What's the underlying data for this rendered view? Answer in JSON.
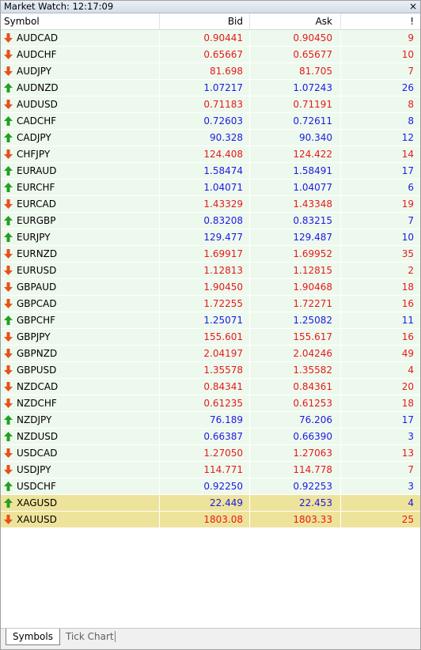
{
  "window": {
    "title": "Market Watch: 12:17:09",
    "close_glyph": "×"
  },
  "columns": {
    "symbol": "Symbol",
    "bid": "Bid",
    "ask": "Ask",
    "spread": "!"
  },
  "rows": [
    {
      "symbol": "AUDCAD",
      "bid": "0.90441",
      "ask": "0.90450",
      "spread": "9",
      "dir": "down"
    },
    {
      "symbol": "AUDCHF",
      "bid": "0.65667",
      "ask": "0.65677",
      "spread": "10",
      "dir": "down"
    },
    {
      "symbol": "AUDJPY",
      "bid": "81.698",
      "ask": "81.705",
      "spread": "7",
      "dir": "down"
    },
    {
      "symbol": "AUDNZD",
      "bid": "1.07217",
      "ask": "1.07243",
      "spread": "26",
      "dir": "up"
    },
    {
      "symbol": "AUDUSD",
      "bid": "0.71183",
      "ask": "0.71191",
      "spread": "8",
      "dir": "down"
    },
    {
      "symbol": "CADCHF",
      "bid": "0.72603",
      "ask": "0.72611",
      "spread": "8",
      "dir": "up"
    },
    {
      "symbol": "CADJPY",
      "bid": "90.328",
      "ask": "90.340",
      "spread": "12",
      "dir": "up"
    },
    {
      "symbol": "CHFJPY",
      "bid": "124.408",
      "ask": "124.422",
      "spread": "14",
      "dir": "down"
    },
    {
      "symbol": "EURAUD",
      "bid": "1.58474",
      "ask": "1.58491",
      "spread": "17",
      "dir": "up"
    },
    {
      "symbol": "EURCHF",
      "bid": "1.04071",
      "ask": "1.04077",
      "spread": "6",
      "dir": "up"
    },
    {
      "symbol": "EURCAD",
      "bid": "1.43329",
      "ask": "1.43348",
      "spread": "19",
      "dir": "down"
    },
    {
      "symbol": "EURGBP",
      "bid": "0.83208",
      "ask": "0.83215",
      "spread": "7",
      "dir": "up"
    },
    {
      "symbol": "EURJPY",
      "bid": "129.477",
      "ask": "129.487",
      "spread": "10",
      "dir": "up"
    },
    {
      "symbol": "EURNZD",
      "bid": "1.69917",
      "ask": "1.69952",
      "spread": "35",
      "dir": "down"
    },
    {
      "symbol": "EURUSD",
      "bid": "1.12813",
      "ask": "1.12815",
      "spread": "2",
      "dir": "down"
    },
    {
      "symbol": "GBPAUD",
      "bid": "1.90450",
      "ask": "1.90468",
      "spread": "18",
      "dir": "down"
    },
    {
      "symbol": "GBPCAD",
      "bid": "1.72255",
      "ask": "1.72271",
      "spread": "16",
      "dir": "down"
    },
    {
      "symbol": "GBPCHF",
      "bid": "1.25071",
      "ask": "1.25082",
      "spread": "11",
      "dir": "up"
    },
    {
      "symbol": "GBPJPY",
      "bid": "155.601",
      "ask": "155.617",
      "spread": "16",
      "dir": "down"
    },
    {
      "symbol": "GBPNZD",
      "bid": "2.04197",
      "ask": "2.04246",
      "spread": "49",
      "dir": "down"
    },
    {
      "symbol": "GBPUSD",
      "bid": "1.35578",
      "ask": "1.35582",
      "spread": "4",
      "dir": "down"
    },
    {
      "symbol": "NZDCAD",
      "bid": "0.84341",
      "ask": "0.84361",
      "spread": "20",
      "dir": "down"
    },
    {
      "symbol": "NZDCHF",
      "bid": "0.61235",
      "ask": "0.61253",
      "spread": "18",
      "dir": "down"
    },
    {
      "symbol": "NZDJPY",
      "bid": "76.189",
      "ask": "76.206",
      "spread": "17",
      "dir": "up"
    },
    {
      "symbol": "NZDUSD",
      "bid": "0.66387",
      "ask": "0.66390",
      "spread": "3",
      "dir": "up"
    },
    {
      "symbol": "USDCAD",
      "bid": "1.27050",
      "ask": "1.27063",
      "spread": "13",
      "dir": "down"
    },
    {
      "symbol": "USDJPY",
      "bid": "114.771",
      "ask": "114.778",
      "spread": "7",
      "dir": "down"
    },
    {
      "symbol": "USDCHF",
      "bid": "0.92250",
      "ask": "0.92253",
      "spread": "3",
      "dir": "up"
    },
    {
      "symbol": "XAGUSD",
      "bid": "22.449",
      "ask": "22.453",
      "spread": "4",
      "dir": "up",
      "highlight": true
    },
    {
      "symbol": "XAUUSD",
      "bid": "1803.08",
      "ask": "1803.33",
      "spread": "25",
      "dir": "down",
      "highlight": true
    }
  ],
  "tabs": [
    {
      "label": "Symbols",
      "active": true
    },
    {
      "label": "Tick Chart",
      "active": false
    }
  ],
  "colors": {
    "up_text": "#1a1ae6",
    "down_text": "#e61a1a",
    "up_arrow": "#22a022",
    "down_arrow": "#e8501a",
    "row_bg": "#eef9ee",
    "highlight_bg": "#eee39a"
  }
}
